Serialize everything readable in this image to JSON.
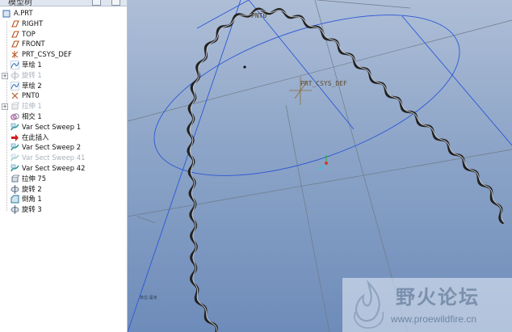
{
  "tree": {
    "header_title": "模型树",
    "items": [
      {
        "label": "A.PRT",
        "icon": "part-icon",
        "indent": 0,
        "expander": false,
        "suppressed": false
      },
      {
        "label": "RIGHT",
        "icon": "datum-plane-icon",
        "indent": 1,
        "expander": false,
        "suppressed": false
      },
      {
        "label": "TOP",
        "icon": "datum-plane-icon",
        "indent": 1,
        "expander": false,
        "suppressed": false
      },
      {
        "label": "FRONT",
        "icon": "datum-plane-icon",
        "indent": 1,
        "expander": false,
        "suppressed": false
      },
      {
        "label": "PRT_CSYS_DEF",
        "icon": "coordinate-system-icon",
        "indent": 1,
        "expander": false,
        "suppressed": false
      },
      {
        "label": "草绘 1",
        "icon": "sketch-icon",
        "indent": 1,
        "expander": false,
        "suppressed": false
      },
      {
        "label": "旋转 1",
        "icon": "revolve-icon",
        "indent": 1,
        "expander": true,
        "suppressed": true
      },
      {
        "label": "草绘 2",
        "icon": "sketch-icon",
        "indent": 1,
        "expander": false,
        "suppressed": false
      },
      {
        "label": "PNT0",
        "icon": "datum-point-icon",
        "indent": 1,
        "expander": false,
        "suppressed": false
      },
      {
        "label": "拉伸 1",
        "icon": "extrude-icon",
        "indent": 1,
        "expander": true,
        "suppressed": true
      },
      {
        "label": "相交 1",
        "icon": "intersect-icon",
        "indent": 1,
        "expander": false,
        "suppressed": false
      },
      {
        "label": "Var Sect Sweep 1",
        "icon": "sweep-icon",
        "indent": 1,
        "expander": false,
        "suppressed": false
      },
      {
        "label": "在此插入",
        "icon": "insert-here-arrow-icon",
        "indent": 1,
        "expander": false,
        "suppressed": false
      },
      {
        "label": "Var Sect Sweep 2",
        "icon": "sweep-icon",
        "indent": 1,
        "expander": false,
        "suppressed": false
      },
      {
        "label": "Var Sect Sweep 41",
        "icon": "sweep-icon",
        "indent": 1,
        "expander": false,
        "suppressed": true
      },
      {
        "label": "Var Sect Sweep 42",
        "icon": "sweep-icon",
        "indent": 1,
        "expander": false,
        "suppressed": false
      },
      {
        "label": "拉伸 75",
        "icon": "extrude-icon",
        "indent": 1,
        "expander": false,
        "suppressed": false
      },
      {
        "label": "旋转 2",
        "icon": "revolve-icon",
        "indent": 1,
        "expander": false,
        "suppressed": false
      },
      {
        "label": "倒角 1",
        "icon": "chamfer-icon",
        "indent": 1,
        "expander": false,
        "suppressed": false
      },
      {
        "label": "旋转 3",
        "icon": "revolve-icon",
        "indent": 1,
        "expander": false,
        "suppressed": false
      }
    ]
  },
  "viewport": {
    "point_label": "PNT0",
    "csys_label": "PRT_CSYS_DEF",
    "corner_label": "单位:毫米"
  },
  "watermark": {
    "text_cn": "野火论坛",
    "url": "www.proewildfire.cn"
  },
  "colors": {
    "viewport_top": "#aebed7",
    "viewport_bottom": "#6e8cba",
    "datum_plane": "#2b57d6",
    "curve_dark": "#2a2a2a",
    "csys": "#8a6a3a"
  }
}
